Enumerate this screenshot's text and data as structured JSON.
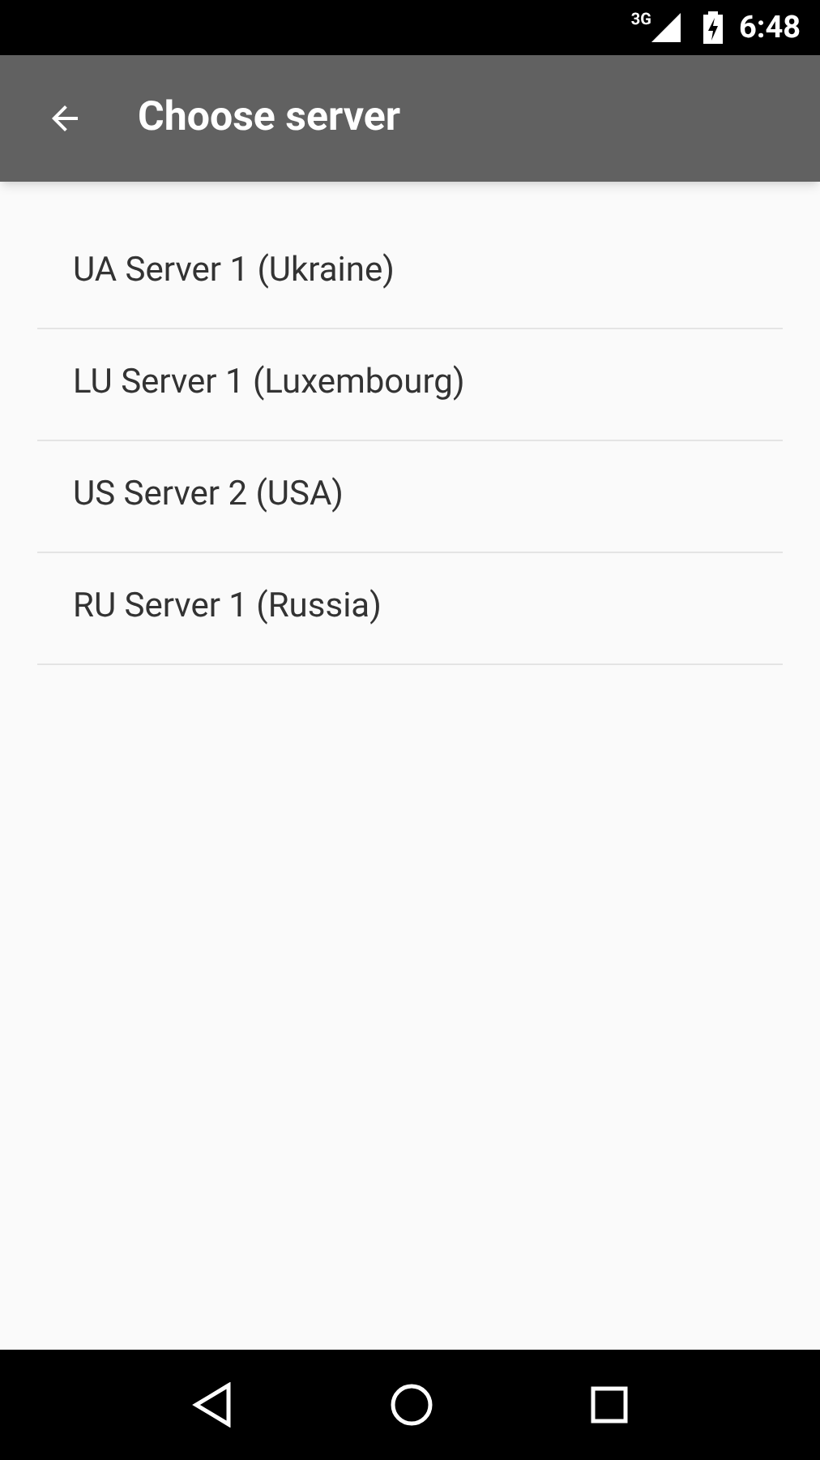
{
  "status_bar": {
    "network": "3G",
    "time": "6:48"
  },
  "toolbar": {
    "title": "Choose server"
  },
  "servers": [
    {
      "label": "UA Server 1 (Ukraine)"
    },
    {
      "label": "LU Server 1 (Luxembourg)"
    },
    {
      "label": "US Server 2 (USA)"
    },
    {
      "label": "RU Server 1 (Russia)"
    }
  ]
}
